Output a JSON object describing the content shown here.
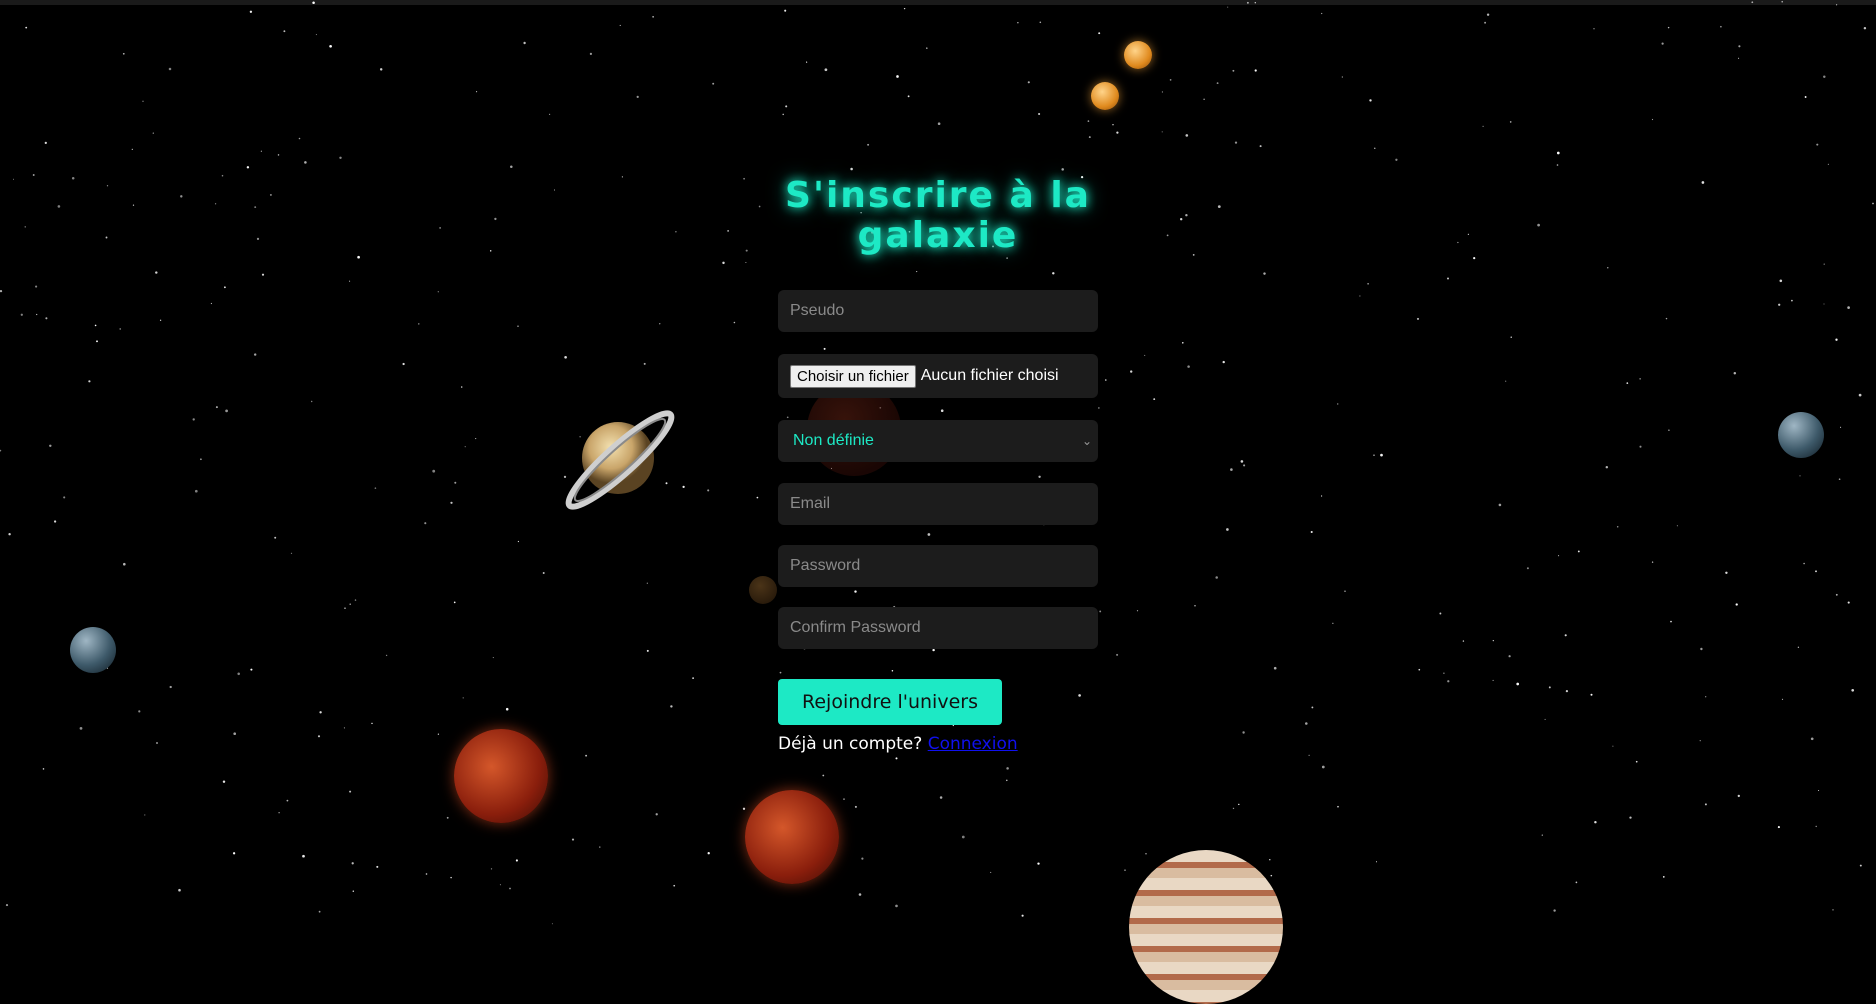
{
  "colors": {
    "accent": "#1de9c5",
    "background": "#000000",
    "field_bg": "#1c1c1c",
    "link": "#1010ee"
  },
  "form": {
    "title": "S'inscrire à la galaxie",
    "pseudo_placeholder": "Pseudo",
    "file_button_label": "Choisir un fichier",
    "file_status": "Aucun fichier choisi",
    "select_value": "Non définie",
    "email_placeholder": "Email",
    "password_placeholder": "Password",
    "confirm_password_placeholder": "Confirm Password",
    "submit_label": "Rejoindre l'univers",
    "login_prompt": "Déjà un compte?",
    "login_link": "Connexion"
  }
}
